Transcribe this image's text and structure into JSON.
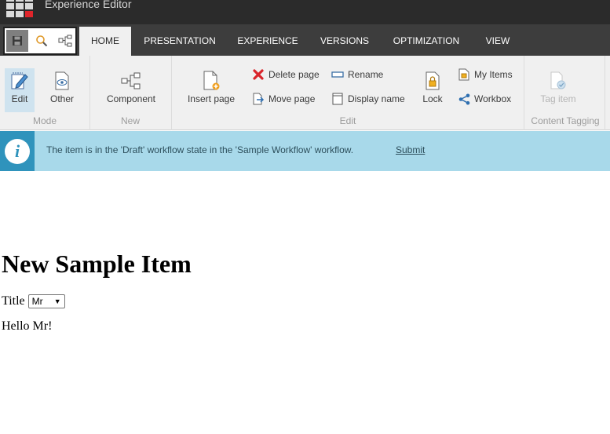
{
  "app": {
    "title": "Experience Editor"
  },
  "tabs": [
    {
      "label": "HOME",
      "active": true
    },
    {
      "label": "PRESENTATION"
    },
    {
      "label": "EXPERIENCE"
    },
    {
      "label": "VERSIONS"
    },
    {
      "label": "OPTIMIZATION"
    },
    {
      "label": "VIEW"
    }
  ],
  "quick_actions": [
    "save-icon",
    "search-icon",
    "tree-icon"
  ],
  "ribbon": {
    "mode": {
      "group_label": "Mode",
      "edit_label": "Edit",
      "other_label": "Other"
    },
    "new": {
      "group_label": "New",
      "component_label": "Component"
    },
    "edit": {
      "group_label": "Edit",
      "insert_page_label": "Insert page",
      "delete_page_label": "Delete page",
      "move_page_label": "Move page",
      "rename_label": "Rename",
      "display_name_label": "Display name",
      "lock_label": "Lock",
      "my_items_label": "My Items",
      "workbox_label": "Workbox"
    },
    "content_tagging": {
      "group_label": "Content Tagging",
      "tag_item_label": "Tag item"
    }
  },
  "notification": {
    "icon": "info-icon",
    "message": "The item is in the 'Draft' workflow state in the 'Sample Workflow' workflow.",
    "action_label": "Submit"
  },
  "page": {
    "heading": "New Sample Item",
    "title_field_label": "Title",
    "title_selected": "Mr",
    "greeting": "Hello Mr!"
  },
  "colors": {
    "titlebar": "#2b2b2b",
    "tabbar": "#3d3d3d",
    "ribbon": "#f0f0f0",
    "notice_bg": "#a8d9ea",
    "notice_icon_bg": "#2f93bc",
    "logo_red": "#e0252b",
    "delete_red": "#d9252b"
  }
}
